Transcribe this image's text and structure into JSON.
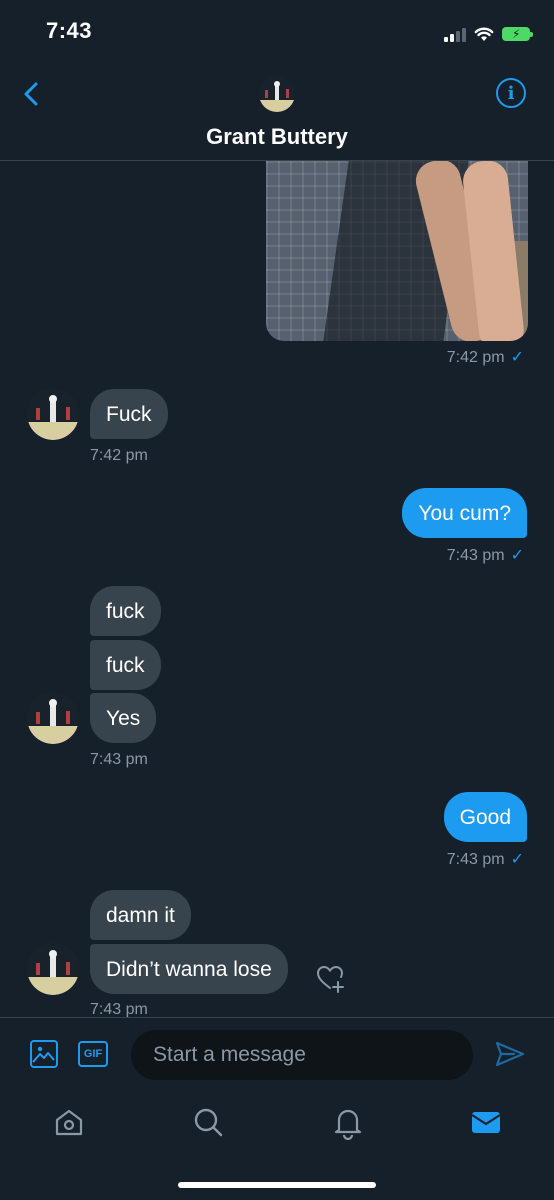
{
  "status_bar": {
    "time": "7:43"
  },
  "header": {
    "title": "Grant Buttery"
  },
  "messages": [
    {
      "text": "Fuck",
      "time": "7:42 pm"
    },
    {
      "text": "You cum?",
      "time": "7:43 pm"
    },
    {
      "text": "fuck"
    },
    {
      "text": "fuck"
    },
    {
      "text": "Yes",
      "time": "7:43 pm"
    },
    {
      "text": "Good",
      "time": "7:43 pm"
    },
    {
      "text": "damn it"
    },
    {
      "text": "Didn’t wanna lose",
      "time": "7:43 pm"
    }
  ],
  "photo_message": {
    "time": "7:42 pm"
  },
  "composer": {
    "placeholder": "Start a message",
    "gif_label": "GIF"
  },
  "icons": {
    "back": "chevron-left-icon",
    "info": "info-icon",
    "photo": "image-icon",
    "gif": "gif-icon",
    "send": "send-icon",
    "react": "heart-plus-icon",
    "tabs": [
      "home-icon",
      "search-icon",
      "bell-icon",
      "mail-icon"
    ]
  },
  "colors": {
    "background": "#15202b",
    "accent": "#1d9bf0",
    "incoming_bubble": "#38444d",
    "muted_text": "#8b98a5"
  }
}
